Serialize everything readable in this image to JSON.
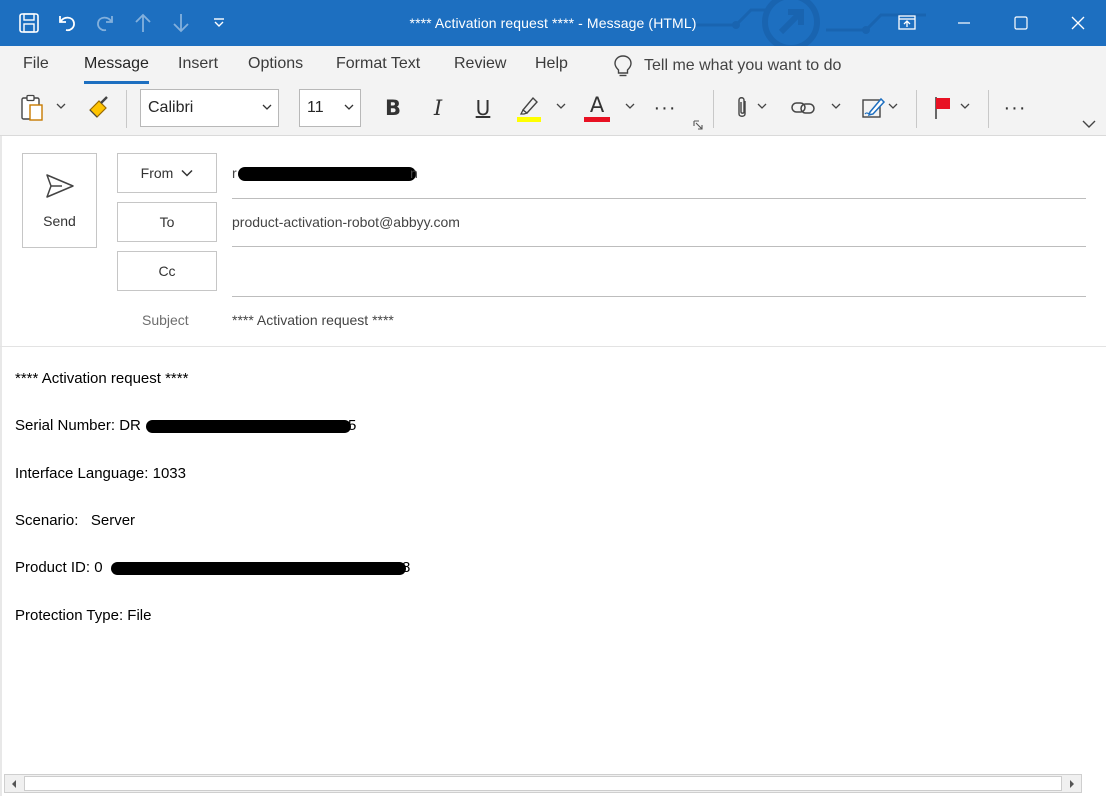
{
  "window": {
    "title": "**** Activation request ****  -  Message (HTML)",
    "accent_color": "#1d6fc0"
  },
  "quick_access": {
    "icons": [
      "save-icon",
      "undo-icon",
      "redo-icon",
      "up-arrow-icon",
      "down-arrow-icon",
      "customize-qat-icon"
    ]
  },
  "window_controls": [
    "restore-window-icon",
    "minimize-icon",
    "maximize-icon",
    "close-icon"
  ],
  "ribbon_tabs": [
    {
      "label": "File",
      "active": false
    },
    {
      "label": "Message",
      "active": true
    },
    {
      "label": "Insert",
      "active": false
    },
    {
      "label": "Options",
      "active": false
    },
    {
      "label": "Format Text",
      "active": false
    },
    {
      "label": "Review",
      "active": false
    },
    {
      "label": "Help",
      "active": false
    }
  ],
  "tell_me": {
    "text": "Tell me what you want to do",
    "icon": "lightbulb-icon"
  },
  "ribbon": {
    "font_name": "Calibri",
    "font_size": "11",
    "bold": "B",
    "italic": "I",
    "underline": "U",
    "font_color_letter": "A",
    "highlight_color": "#ffff00",
    "font_color": "#e81123",
    "more": "···"
  },
  "compose": {
    "send_label": "Send",
    "from_label": "From",
    "to_label": "To",
    "cc_label": "Cc",
    "subject_label": "Subject",
    "from_value_fragment_start": "r",
    "from_value_fragment_end": "n",
    "to_value": "product-activation-robot@abbyy.com",
    "cc_value": "",
    "subject_value": "**** Activation request ****"
  },
  "body": {
    "heading": "**** Activation request ****",
    "serial_label": "Serial Number: DR",
    "serial_suffix": "5",
    "interface_language": "Interface Language: 1033",
    "scenario": "Scenario:   Server",
    "product_id_label": "Product ID: 0",
    "product_id_suffix": "8",
    "protection_type": "Protection Type: File"
  }
}
